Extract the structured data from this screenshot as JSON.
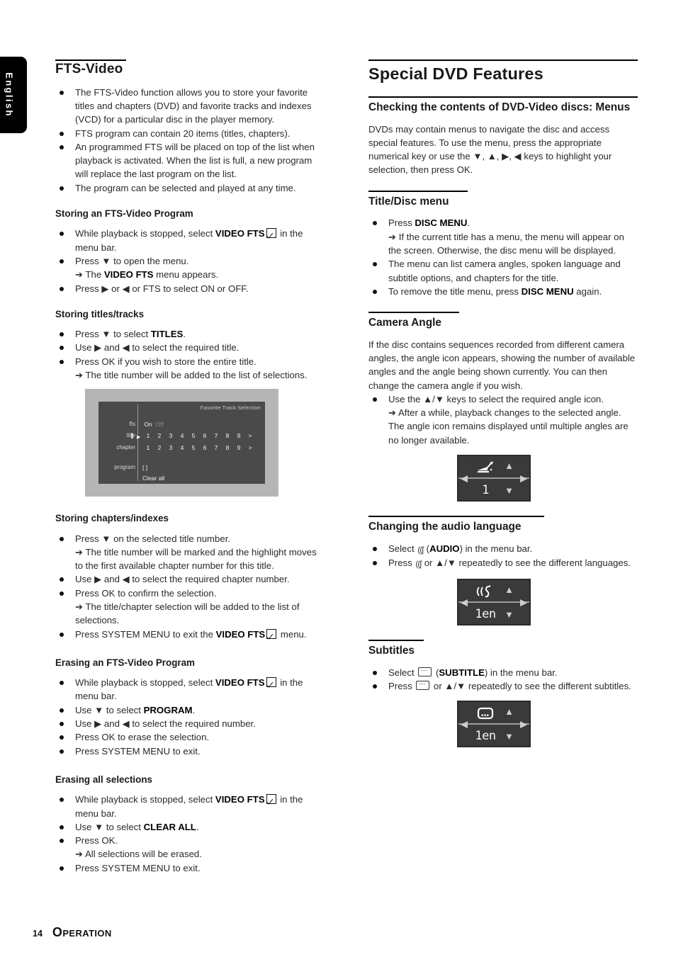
{
  "page": {
    "language_tab": "English",
    "footer_page_number": "14",
    "footer_section_first": "O",
    "footer_section_rest": "PERATION"
  },
  "left_column": {
    "heading": "FTS-Video",
    "intro_bullets": [
      "The FTS-Video function allows you to store your favorite titles and chapters (DVD) and favorite tracks and indexes (VCD) for a particular disc in the player memory.",
      "FTS program can contain 20 items (titles, chapters).",
      "An programmed FTS will be placed on top of the list when playback is activated. When the list is full, a new program will replace the last program on the list.",
      "The program can be selected and played at any time."
    ],
    "storing_program": {
      "heading": "Storing an FTS-Video Program",
      "b1_pre": "While playback is stopped, select ",
      "b1_bold": "VIDEO FTS",
      "b1_post": " in the menu bar.",
      "b2": "Press ▼ to open the menu.",
      "b2_arrow_pre": "➔ The ",
      "b2_arrow_bold": "VIDEO FTS",
      "b2_arrow_post": " menu appears.",
      "b3": "Press ▶ or ◀ or FTS to select ON or OFF."
    },
    "storing_titles": {
      "heading": "Storing titles/tracks",
      "b1_pre": "Press ▼ to select ",
      "b1_bold": "TITLES",
      "b1_post": ".",
      "b2": "Use ▶ and ◀ to select the required title.",
      "b3": "Press OK if you wish to store the entire title.",
      "b3_arrow": "➔ The title number will be added to the list of selections."
    },
    "osd_screen": {
      "title": "Favorite Track Selection",
      "rows": [
        {
          "label": "fts",
          "values": [
            "On",
            "Off"
          ],
          "dim_index": 1
        },
        {
          "label": "title",
          "values": [
            "1",
            "2",
            "3",
            "4",
            "5",
            "6",
            "7",
            "8",
            "9",
            ">"
          ]
        },
        {
          "label": "chapter",
          "values": [
            "1",
            "2",
            "3",
            "4",
            "5",
            "6",
            "7",
            "8",
            "9",
            ">"
          ]
        }
      ],
      "program_label": "program",
      "program_value": "[ ]",
      "clear_all": "Clear all"
    },
    "storing_chapters": {
      "heading": "Storing chapters/indexes",
      "b1": "Press ▼ on the selected title number.",
      "b1_arrow": "➔ The title number will be marked and the highlight moves to the first available chapter number for this title.",
      "b2": "Use ▶ and ◀ to select the required chapter number.",
      "b3": "Press OK to confirm the selection.",
      "b3_arrow": "➔ The title/chapter selection will be added to the list of selections.",
      "b4_pre": "Press SYSTEM MENU to exit the ",
      "b4_bold": "VIDEO FTS",
      "b4_post": " menu."
    },
    "erasing_program": {
      "heading": "Erasing an FTS-Video Program",
      "b1_pre": "While playback is stopped, select ",
      "b1_bold": "VIDEO FTS",
      "b1_post": " in the menu bar.",
      "b2_pre": "Use ▼ to select ",
      "b2_bold": "PROGRAM",
      "b2_post": ".",
      "b3": "Use ▶ and ◀ to select the required number.",
      "b4": "Press OK to erase the selection.",
      "b5": "Press SYSTEM MENU to exit."
    },
    "erasing_all": {
      "heading": "Erasing all selections",
      "b1_pre": "While playback is stopped, select ",
      "b1_bold": "VIDEO FTS",
      "b1_post": " in the menu bar.",
      "b2_pre": "Use ▼ to select ",
      "b2_bold": "CLEAR ALL",
      "b2_post": ".",
      "b3": "Press OK.",
      "b3_arrow": "➔ All selections will be erased.",
      "b4": "Press SYSTEM MENU to exit."
    }
  },
  "right_column": {
    "main_heading": "Special DVD Features",
    "checking_menus": {
      "heading": "Checking the contents of DVD-Video discs: Menus",
      "paragraph": "DVDs may contain menus to navigate the disc and access special features. To use the menu, press the appropriate numerical key or use the ▼, ▲, ▶, ◀ keys to highlight your selection, then press OK."
    },
    "title_disc_menu": {
      "heading": "Title/Disc menu",
      "b1_pre": "Press ",
      "b1_bold": "DISC MENU",
      "b1_post": ".",
      "b1_arrow": "➔ If the current title has a menu, the menu will appear on the screen. Otherwise, the disc menu will be displayed.",
      "b2": "The menu can list camera angles, spoken language and subtitle options, and chapters for the title.",
      "b3_pre": "To remove the title menu, press ",
      "b3_bold": "DISC MENU",
      "b3_post": " again."
    },
    "camera_angle": {
      "heading": "Camera Angle",
      "paragraph": "If the disc contains sequences recorded from different camera angles, the angle icon appears, showing the number of available angles and the angle being shown currently. You can then change the camera angle if you wish.",
      "b1": "Use the ▲/▼ keys to select the required angle icon.",
      "b1_arrow": "➔ After a while, playback changes to the selected angle. The angle  icon remains displayed until multiple angles are no longer available.",
      "osd_value": "1",
      "osd_icon": "camera-angle-icon"
    },
    "audio_language": {
      "heading": "Changing the audio language",
      "b1_pre": "Select ",
      "b1_mid": " (",
      "b1_bold": "AUDIO",
      "b1_post": ") in the menu bar.",
      "b2_pre": "Press ",
      "b2_post": " or ▲/▼ repeatedly to see the different languages.",
      "osd_value": "1en",
      "osd_icon": "audio-icon"
    },
    "subtitles": {
      "heading": "Subtitles",
      "b1_pre": "Select ",
      "b1_mid": " (",
      "b1_bold": "SUBTITLE",
      "b1_post": ") in the menu bar.",
      "b2_pre": "Press ",
      "b2_post": " or ▲/▼ repeatedly to see the different subtitles.",
      "osd_value": "1en",
      "osd_icon": "subtitle-icon"
    }
  }
}
